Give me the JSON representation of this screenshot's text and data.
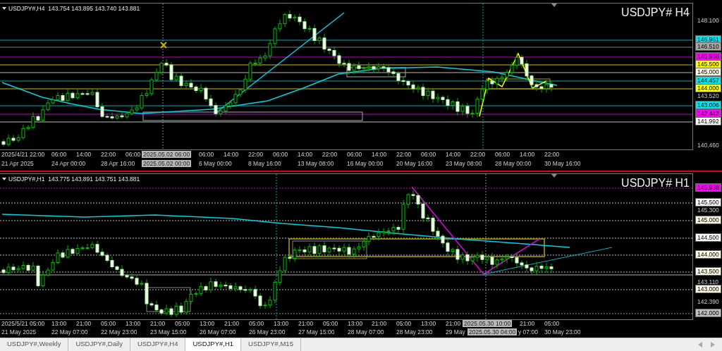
{
  "charts": [
    {
      "header": "USDJPY#,H4  143.754 143.895 143.740 143.881",
      "title": "USDJPY# H4",
      "price_axis": [
        {
          "label": "148.100",
          "kind": "tick"
        },
        {
          "label": "146.961",
          "kind": "tag",
          "color": "#00e5ee"
        },
        {
          "label": "146.510",
          "kind": "tag",
          "color": "#a8a8a8"
        },
        {
          "label": "145.938",
          "kind": "tag",
          "color": "#ff00ff"
        },
        {
          "label": "145.500",
          "kind": "tag",
          "color": "#ffff00"
        },
        {
          "label": "145.000",
          "kind": "tag",
          "color": "#fffbe6"
        },
        {
          "label": "144.457",
          "kind": "tag",
          "color": "#00e5ee"
        },
        {
          "label": "144.000",
          "kind": "tag",
          "color": "#ffff00"
        },
        {
          "label": "143.520",
          "kind": "tick"
        },
        {
          "label": "143.006",
          "kind": "tag",
          "color": "#00e5ee"
        },
        {
          "label": "142.442",
          "kind": "tag",
          "color": "#ff00ff"
        },
        {
          "label": "141.992",
          "kind": "tag",
          "color": "#ffffff"
        },
        {
          "label": "140.460",
          "kind": "tick"
        }
      ],
      "time_row_1": [
        "2025/4/21",
        "22:00",
        "06:00",
        "14:00",
        "22:00",
        "06:00",
        "06:00",
        "14:00",
        "22:00",
        "06:00",
        "14:00",
        "22:00",
        "06:00",
        "14:00",
        "22:00",
        "06:00",
        "14:00",
        "22:00",
        "06:00",
        "14:00",
        "22:00"
      ],
      "time_row_2": [
        "21 Apr 2025",
        "24 Apr 00:00",
        "28 Apr 16:00",
        "6 May 00:00",
        "8 May 16:00",
        "13 May 08:00",
        "16 May 00:00",
        "20 May 16:00",
        "23 May 08:00",
        "28 May 00:00",
        "30 May 16:00"
      ],
      "cursor_tags": [
        "2025.05.02 06:00",
        "2025.05.02 00:00"
      ]
    },
    {
      "header": "USDJPY#,H1  143.775 143.891 143.751 143.881",
      "title": "USDJPY# H1",
      "price_axis": [
        {
          "label": "145.938",
          "kind": "tag",
          "color": "#ff00ff"
        },
        {
          "label": "145.500",
          "kind": "tag",
          "color": "#ffffff"
        },
        {
          "label": "145.300",
          "kind": "tick"
        },
        {
          "label": "145.000",
          "kind": "tag",
          "color": "#fffbe6"
        },
        {
          "label": "144.500",
          "kind": "tag",
          "color": "#ffffff"
        },
        {
          "label": "144.000",
          "kind": "tag",
          "color": "#fffbe6"
        },
        {
          "label": "143.500",
          "kind": "tag",
          "color": "#fffbe6"
        },
        {
          "label": "143.110",
          "kind": "tick"
        },
        {
          "label": "143.000",
          "kind": "tag",
          "color": "#fffbe6"
        },
        {
          "label": "142.390",
          "kind": "tick"
        },
        {
          "label": "142.000",
          "kind": "tag",
          "color": "#c0c0c0"
        }
      ],
      "time_row_1": [
        "2025/5/21",
        "05:00",
        "13:00",
        "21:00",
        "05:00",
        "13:00",
        "21:00",
        "05:00",
        "13:00",
        "21:00",
        "05:00",
        "13:00",
        "21:00",
        "05:00",
        "13:00",
        "21:00",
        "05:00",
        "13:00",
        "21:00",
        "21:00",
        "05:00"
      ],
      "time_row_2": [
        "21 May 2025",
        "22 May 07:00",
        "22 May 23:00",
        "23 May 15:00",
        "26 May 07:00",
        "26 May 23:00",
        "27 May 15:00",
        "28 May 07:00",
        "28 May 23:00",
        "29 May",
        "y 07:00",
        "30 May 23:00"
      ],
      "cursor_tags": [
        "2025.05.30 10:00",
        "2025.05.30 04:00"
      ]
    }
  ],
  "tabs": [
    {
      "label": "USDJPY#,Weekly",
      "selected": false
    },
    {
      "label": "USDJPY#,Daily",
      "selected": false
    },
    {
      "label": "USDJPY#,H4",
      "selected": false
    },
    {
      "label": "USDJPY#,H1",
      "selected": true
    },
    {
      "label": "USDJPY#,M15",
      "selected": false
    }
  ]
}
